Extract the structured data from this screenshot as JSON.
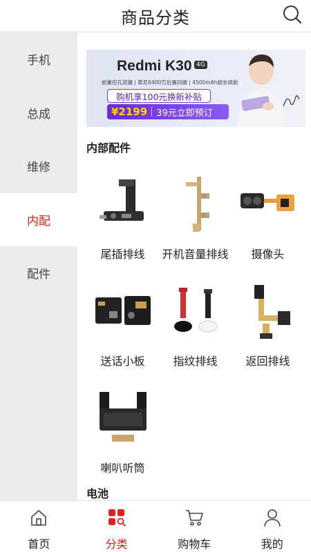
{
  "header": {
    "title": "商品分类"
  },
  "sidebar": {
    "items": [
      {
        "label": "手机"
      },
      {
        "label": "总成"
      },
      {
        "label": "维修"
      },
      {
        "label": "内配",
        "active": true
      },
      {
        "label": "配件"
      }
    ]
  },
  "banner": {
    "brand": "Redmi K30",
    "badge": "4G",
    "features": "前置挖孔双摄 | 索尼6400万后置四摄 | 4500mAh超长续航",
    "promo": "购机享100元换新补贴",
    "price": "¥2199",
    "preorder": "39元立即预订",
    "signature_name": "王一博"
  },
  "sections": [
    {
      "title": "内部配件",
      "items": [
        {
          "label": "尾插排线",
          "icon": "tail-plug-flex-cable-image"
        },
        {
          "label": "开机音量排线",
          "icon": "power-volume-flex-cable-image"
        },
        {
          "label": "摄像头",
          "icon": "camera-module-image"
        },
        {
          "label": "送话小板",
          "icon": "microphone-board-image"
        },
        {
          "label": "指纹排线",
          "icon": "fingerprint-flex-cable-image"
        },
        {
          "label": "返回排线",
          "icon": "back-button-flex-cable-image"
        },
        {
          "label": "喇叭听筒",
          "icon": "speaker-earpiece-image"
        }
      ]
    },
    {
      "title": "电池",
      "items": []
    }
  ],
  "tabbar": {
    "items": [
      {
        "label": "首页",
        "icon": "home-icon"
      },
      {
        "label": "分类",
        "icon": "category-icon",
        "active": true
      },
      {
        "label": "购物车",
        "icon": "cart-icon"
      },
      {
        "label": "我的",
        "icon": "user-icon"
      }
    ]
  },
  "colors": {
    "accent": "#e0201b",
    "sidebar_bg": "#ececec",
    "promo_purple": "#6d28d9"
  }
}
